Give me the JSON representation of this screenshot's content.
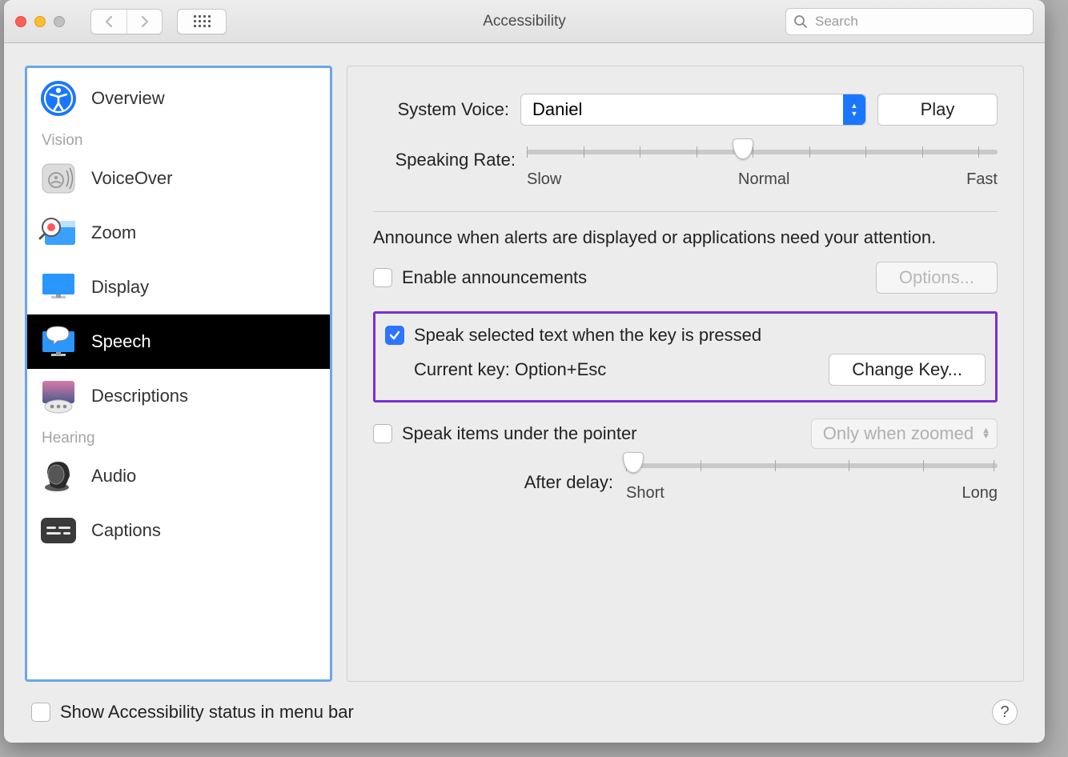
{
  "title": "Accessibility",
  "search_placeholder": "Search",
  "sidebar": {
    "items": [
      {
        "label": "Overview"
      },
      {
        "label": "VoiceOver"
      },
      {
        "label": "Zoom"
      },
      {
        "label": "Display"
      },
      {
        "label": "Speech"
      },
      {
        "label": "Descriptions"
      },
      {
        "label": "Audio"
      },
      {
        "label": "Captions"
      }
    ],
    "section_vision": "Vision",
    "section_hearing": "Hearing"
  },
  "panel": {
    "system_voice_label": "System Voice:",
    "system_voice_value": "Daniel",
    "play_button": "Play",
    "speaking_rate_label": "Speaking Rate:",
    "rate_slow": "Slow",
    "rate_normal": "Normal",
    "rate_fast": "Fast",
    "announce_desc": "Announce when alerts are displayed or applications need your attention.",
    "enable_announcements": "Enable announcements",
    "options_button": "Options...",
    "speak_selected": "Speak selected text when the key is pressed",
    "current_key": "Current key: Option+Esc",
    "change_key": "Change Key...",
    "speak_pointer": "Speak items under the pointer",
    "only_zoomed": "Only when zoomed",
    "after_delay": "After delay:",
    "delay_short": "Short",
    "delay_long": "Long"
  },
  "footer": {
    "show_status": "Show Accessibility status in menu bar"
  }
}
